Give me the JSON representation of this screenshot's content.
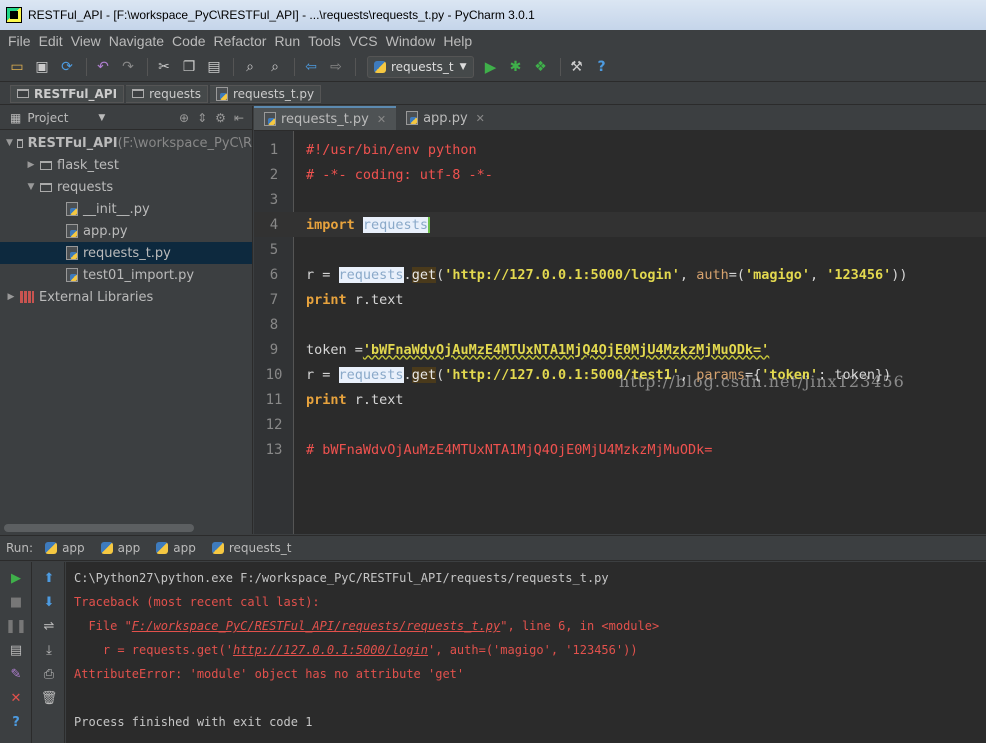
{
  "window": {
    "title": "RESTFul_API - [F:\\workspace_PyC\\RESTFul_API] - ...\\requests\\requests_t.py - PyCharm 3.0.1"
  },
  "menu": [
    {
      "label": "File"
    },
    {
      "label": "Edit"
    },
    {
      "label": "View"
    },
    {
      "label": "Navigate"
    },
    {
      "label": "Code"
    },
    {
      "label": "Refactor"
    },
    {
      "label": "Run"
    },
    {
      "label": "Tools"
    },
    {
      "label": "VCS"
    },
    {
      "label": "Window"
    },
    {
      "label": "Help"
    }
  ],
  "toolbar": {
    "run_config": "requests_t",
    "help": "?"
  },
  "breadcrumb": [
    {
      "label": "RESTFul_API",
      "bold": true
    },
    {
      "label": "requests"
    },
    {
      "label": "requests_t.py"
    }
  ],
  "project": {
    "header": "Project",
    "tree": [
      {
        "label": "RESTFul_API",
        "dim": " (F:\\workspace_PyC\\R",
        "indent": 0,
        "arrow": "▼",
        "type": "folder",
        "bold": true
      },
      {
        "label": "flask_test",
        "indent": 1,
        "arrow": "▶",
        "type": "folder"
      },
      {
        "label": "requests",
        "indent": 1,
        "arrow": "▼",
        "type": "folder"
      },
      {
        "label": "__init__.py",
        "indent": 2,
        "arrow": "",
        "type": "py"
      },
      {
        "label": "app.py",
        "indent": 2,
        "arrow": "",
        "type": "py"
      },
      {
        "label": "requests_t.py",
        "indent": 2,
        "arrow": "",
        "type": "py",
        "selected": true
      },
      {
        "label": "test01_import.py",
        "indent": 2,
        "arrow": "",
        "type": "py"
      },
      {
        "label": "External Libraries",
        "indent": 0,
        "arrow": "▶",
        "type": "lib"
      }
    ]
  },
  "tabs": [
    {
      "label": "requests_t.py",
      "active": true
    },
    {
      "label": "app.py",
      "active": false
    }
  ],
  "code": {
    "l1": "#!/usr/bin/env python",
    "l2": "# -*- coding: utf-8 -*-",
    "l4_kw": "import",
    "l4_mod": "requests",
    "l6_a": "r = ",
    "l6_mod": "requests",
    "l6_dot": ".",
    "l6_get": "get",
    "l6_b": "(",
    "l6_url": "'http://127.0.0.1:5000/login'",
    "l6_c": ", ",
    "l6_auth": "auth",
    "l6_d": "=(",
    "l6_u": "'magigo'",
    "l6_e": ", ",
    "l6_p": "'123456'",
    "l6_f": "))",
    "l7_kw": "print",
    "l7_rest": " r.text",
    "l9_a": "token =",
    "l9_tok": "'bWFnaWdvOjAuMzE4MTUxNTA1MjQ4OjE0MjU4MzkzMjMuODk='",
    "l10_a": "r = ",
    "l10_mod": "requests",
    "l10_dot": ".",
    "l10_get": "get",
    "l10_b": "(",
    "l10_url": "'http://127.0.0.1:5000/test1'",
    "l10_c": ", ",
    "l10_params": "params",
    "l10_d": "={",
    "l10_key": "'token'",
    "l10_e": ": token})",
    "l11_kw": "print",
    "l11_rest": " r.text",
    "l13": "# bWFnaWdvOjAuMzE4MTUxNTA1MjQ4OjE0MjU4MzkzMjMuODk="
  },
  "watermark": "http://blog.csdn.net/jinx123456",
  "run": {
    "label": "Run:",
    "tabs": [
      {
        "label": "app"
      },
      {
        "label": "app"
      },
      {
        "label": "app"
      },
      {
        "label": "requests_t"
      }
    ],
    "console": {
      "cmd": "C:\\Python27\\python.exe F:/workspace_PyC/RESTFul_API/requests/requests_t.py",
      "tb": "Traceback (most recent call last):",
      "file_pre": "  File \"",
      "file_link": "F:/workspace_PyC/RESTFul_API/requests/requests_t.py",
      "file_post": "\", line 6, in <module>",
      "code_pre": "    r = requests.get('",
      "code_link": "http://127.0.0.1:5000/login",
      "code_post": "', auth=('magigo', '123456'))",
      "err": "AttributeError: 'module' object has no attribute 'get'",
      "done": "Process finished with exit code 1"
    }
  },
  "colors": {
    "bg": "#3c3f41",
    "editor_bg": "#2b2b2b",
    "error": "#e2514c",
    "keyword": "#e8a33d",
    "string": "#e3d94f"
  }
}
